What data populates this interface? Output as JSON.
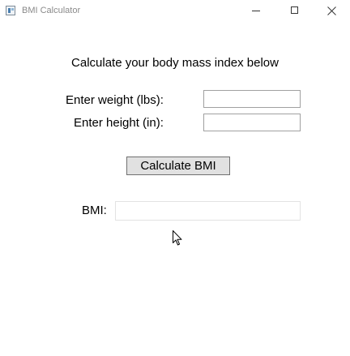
{
  "window": {
    "title": "BMI Calculator",
    "icon": "app-icon"
  },
  "caption_buttons": {
    "minimize": "minimize-icon",
    "maximize": "maximize-icon",
    "close": "close-icon"
  },
  "form": {
    "heading": "Calculate your body mass index below",
    "weight_label": "Enter weight (lbs):",
    "weight_value": "",
    "height_label": "Enter height (in):",
    "height_value": "",
    "calculate_label": "Calculate BMI",
    "bmi_label": "BMI:",
    "bmi_value": ""
  },
  "colors": {
    "title_text": "#8a8a8a",
    "button_face": "#e1e1e1",
    "button_border": "#707070",
    "textbox_border": "#a0a0a0",
    "readonly_border": "#e3e3e3"
  }
}
